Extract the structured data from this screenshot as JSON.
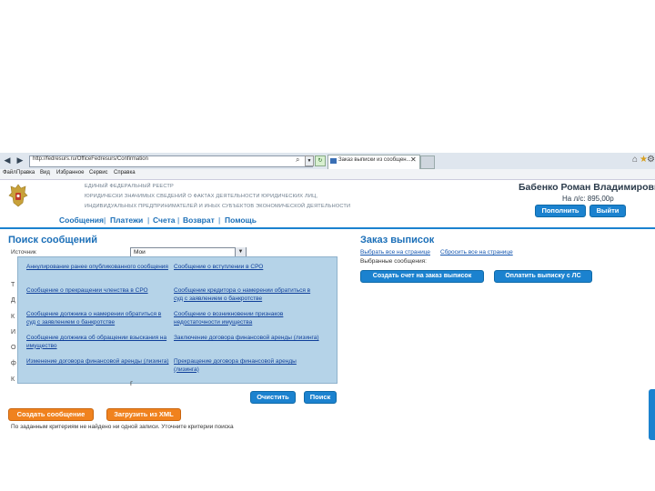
{
  "browser": {
    "back_icon": "back-arrow-icon",
    "address": "http://fedresurs.ru/OfficeFedresurs/Confirmation",
    "tab_title": "Заказ выписки из сообщен...",
    "menu": [
      "Файл",
      "Правка",
      "Вид",
      "Избранное",
      "Сервис",
      "Справка"
    ]
  },
  "header": {
    "registry_lines": [
      "ЕДИНЫЙ ФЕДЕРАЛЬНЫЙ РЕЕСТР",
      "ЮРИДИЧЕСКИ ЗНАЧИМЫХ СВЕДЕНИЙ О ФАКТАХ ДЕЯТЕЛЬНОСТИ ЮРИДИЧЕСКИХ ЛИЦ,",
      "ИНДИВИДУАЛЬНЫХ ПРЕДПРИНИМАТЕЛЕЙ И ИНЫХ СУБЪЕКТОВ ЭКОНОМИЧЕСКОЙ ДЕЯТЕЛЬНОСТИ"
    ],
    "user_name": "Бабенко Роман Владимирович",
    "balance": "На л/с: 895,00р",
    "topup_label": "Пополнить",
    "logout_label": "Выйти",
    "nav": [
      "Сообщения",
      "Платежи",
      "Счета",
      "Возврат",
      "Помощь"
    ]
  },
  "search": {
    "title": "Поиск сообщений",
    "label": "Источник",
    "select_value": "Мои",
    "clear_label": "Очистить",
    "search_label": "Поиск",
    "create_label": "Создать сообщение",
    "upload_label": "Загрузить из XML",
    "no_results": "По заданным критериям не найдено ни одной записи. Уточните критерии поиска"
  },
  "dropdown_items": [
    "Аннулирование ранее опубликованного сообщения",
    "Сообщение о вступлении в СРО",
    "Сообщение о прекращении членства в СРО",
    "Сообщение кредитора о намерении обратиться в суд с заявлением о банкротстве",
    "Сообщение должника о намерении обратиться в суд с заявлением о банкротстве",
    "Сообщение о возникновении признаков недостаточности имущества",
    "Сообщение должника об обращении взыскания на имущество",
    "Заключение договора финансовой аренды (лизинга)",
    "Изменение договора финансовой аренды (лизинга)",
    "Прекращение договора финансовой аренды (лизинга)"
  ],
  "order": {
    "title": "Заказ выписок",
    "select_all": "Выбрать все на странице",
    "reset_all": "Сбросить все на странице",
    "selected_label": "Выбранные сообщения:",
    "create_invoice": "Создать счет на заказ выписок",
    "pay": "Оплатить выписку с ЛС"
  }
}
